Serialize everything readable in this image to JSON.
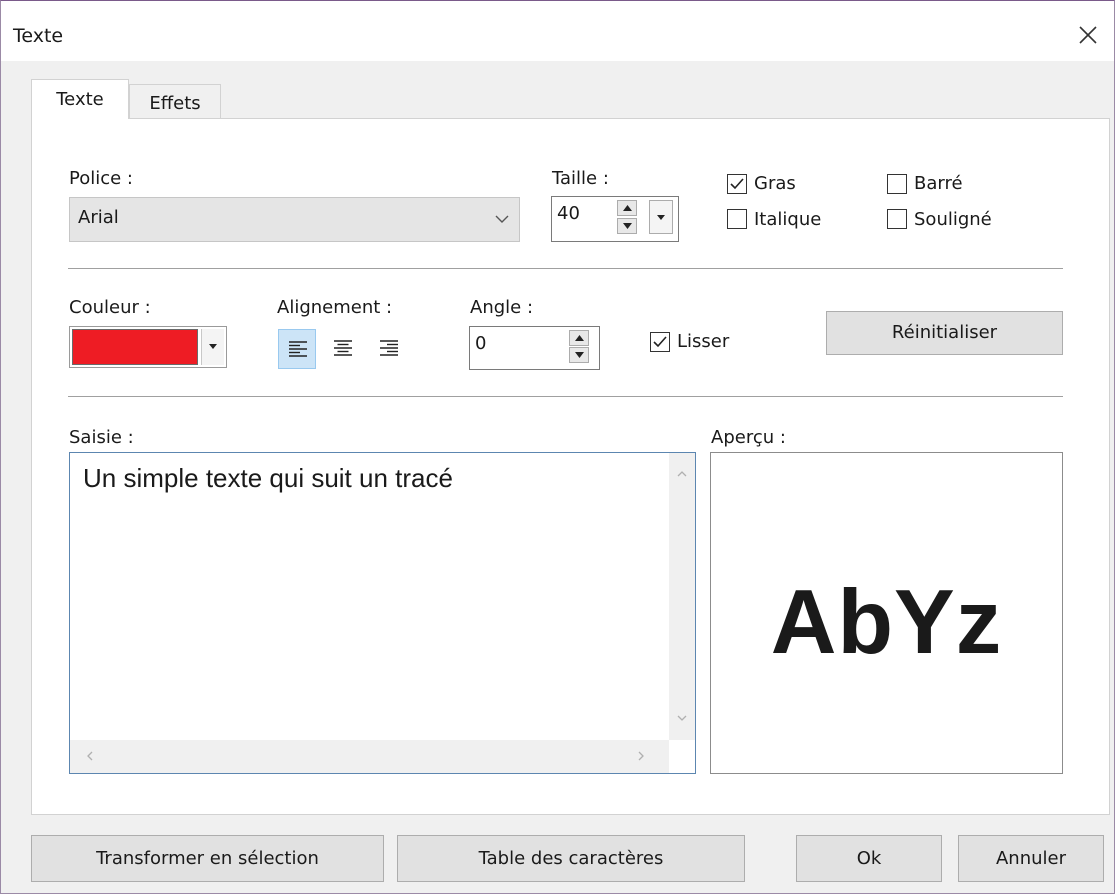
{
  "window": {
    "title": "Texte"
  },
  "tabs": [
    {
      "label": "Texte",
      "active": true
    },
    {
      "label": "Effets",
      "active": false
    }
  ],
  "font": {
    "label": "Police :",
    "value": "Arial"
  },
  "size": {
    "label": "Taille :",
    "value": "40"
  },
  "styles": {
    "bold": {
      "label": "Gras",
      "checked": true
    },
    "italic": {
      "label": "Italique",
      "checked": false
    },
    "strike": {
      "label": "Barré",
      "checked": false
    },
    "underline": {
      "label": "Souligné",
      "checked": false
    }
  },
  "color": {
    "label": "Couleur :",
    "value": "#ee1c24"
  },
  "alignment": {
    "label": "Alignement :",
    "options": [
      "left",
      "center",
      "right"
    ],
    "selected": "left"
  },
  "angle": {
    "label": "Angle :",
    "value": "0"
  },
  "smooth": {
    "label": "Lisser",
    "checked": true
  },
  "reset_button": "Réinitialiser",
  "input": {
    "label": "Saisie :",
    "text": "Un simple texte qui suit un tracé"
  },
  "preview": {
    "label": "Aperçu :",
    "sample": "AbYz"
  },
  "buttons": {
    "transform": "Transformer en sélection",
    "charmap": "Table des caractères",
    "ok": "Ok",
    "cancel": "Annuler"
  },
  "icons": [
    "close-icon",
    "chevron-down-icon",
    "spin-up-icon",
    "spin-down-icon",
    "dropdown-arrow-icon",
    "check-icon",
    "align-left-icon",
    "align-center-icon",
    "align-right-icon",
    "scroll-up-icon",
    "scroll-down-icon",
    "scroll-left-icon",
    "scroll-right-icon"
  ]
}
